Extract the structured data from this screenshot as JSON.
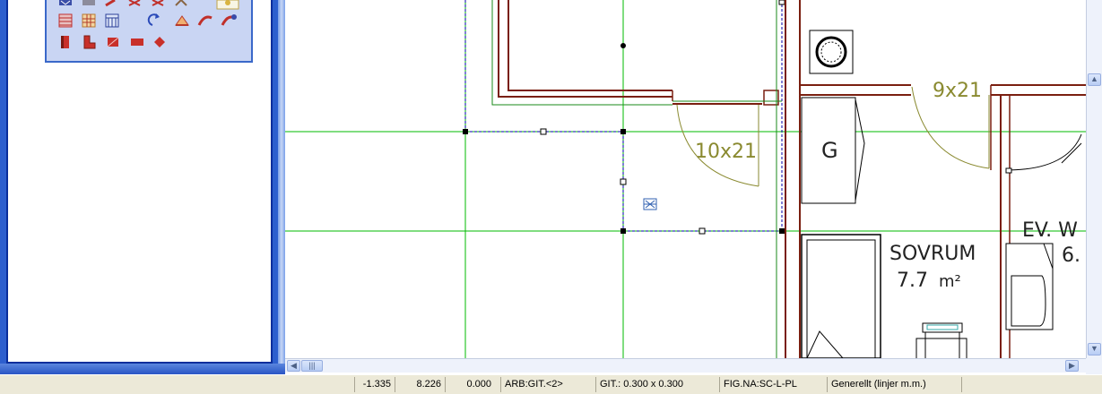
{
  "palette": {
    "icons": [
      "fill-pattern-icon",
      "hatch-grid-icon",
      "wall-grid-icon",
      "rotate-arrow-icon",
      "roof-icon",
      "arc-brush-icon",
      "arc-brush-alt-icon",
      "door-frame-icon",
      "corner-wall-icon",
      "stair-icon",
      "slab-icon",
      "diamond-icon",
      "selected-tool-icon"
    ]
  },
  "drawing": {
    "labels": {
      "door_10x21": "10x21",
      "door_9x21": "9x21",
      "appliance_g": "G",
      "room_name": "SOVRUM",
      "room_area_value": "7.7",
      "room_area_unit": "m²",
      "room_partial_name": "EV. W",
      "room_partial_area": "6."
    },
    "colors": {
      "wall": "#7a1f10",
      "guide": "#00bb00",
      "door": "#8a8a30",
      "selection": "#0000aa"
    }
  },
  "statusbar": {
    "x": "-1.335",
    "y": "8.226",
    "z": "0.000",
    "layer": "ARB:GIT.<2>",
    "grid": "GIT.: 0.300 x 0.300",
    "figure": "FIG.NA:SC-L-PL",
    "linetype": "Generellt (linjer m.m.)"
  }
}
